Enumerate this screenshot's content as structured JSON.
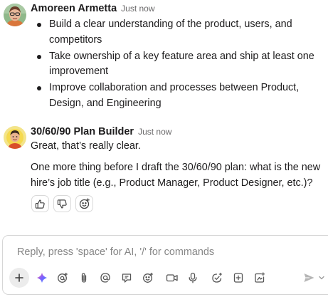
{
  "messages": [
    {
      "sender": "Amoreen Armetta",
      "time": "Just now",
      "bullets": [
        "Build a clear understanding of the product, users, and competitors",
        "Take ownership of a key feature area and ship at least one improvement",
        "Improve collaboration and processes between Product, Design, and Engineering"
      ]
    },
    {
      "sender": "30/60/90 Plan Builder",
      "time": "Just now",
      "paragraphs": [
        "Great, that’s really clear.",
        "One more thing before I draft the 30/60/90 plan: what is the new hire’s job title (e.g., Product Manager, Product Designer, etc.)?"
      ]
    }
  ],
  "reactions": [
    {
      "icon": "thumbs-up-icon"
    },
    {
      "icon": "thumbs-down-icon"
    },
    {
      "icon": "add-emoji-icon"
    }
  ],
  "composer": {
    "placeholder": "Reply, press 'space' for AI, '/' for commands",
    "tools": [
      "add-icon",
      "ai-sparkle-icon",
      "mention-ai-icon",
      "attachment-icon",
      "at-mention-icon",
      "comment-icon",
      "emoji-icon",
      "video-icon",
      "microphone-icon",
      "add-task-icon",
      "new-doc-icon",
      "whiteboard-icon",
      "send-icon",
      "chevron-down-icon"
    ]
  },
  "colors": {
    "text": "#1d1c1d",
    "muted": "#6b6a6b",
    "placeholder": "#868686",
    "border": "#d6d6d6",
    "ai_gradient": [
      "#ff5f9e",
      "#7b61ff",
      "#3c8bff"
    ]
  }
}
